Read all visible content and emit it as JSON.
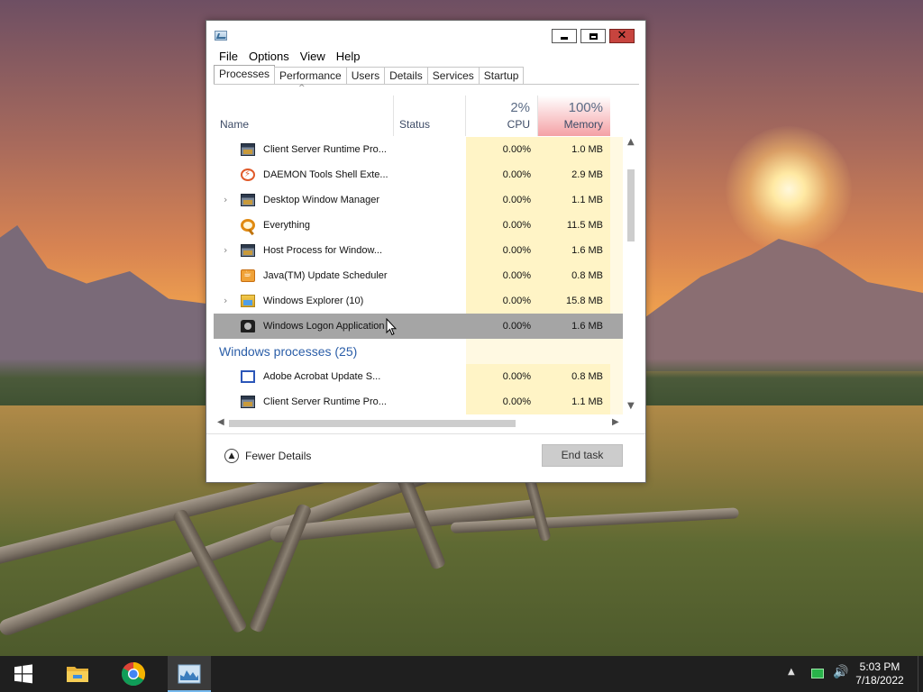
{
  "menu": [
    "File",
    "Options",
    "View",
    "Help"
  ],
  "tabs": [
    "Processes",
    "Performance",
    "Users",
    "Details",
    "Services",
    "Startup"
  ],
  "active_tab": "Processes",
  "header": {
    "name": "Name",
    "status": "Status",
    "cpu_pct": "2%",
    "cpu": "CPU",
    "mem_pct": "100%",
    "mem": "Memory"
  },
  "rows": [
    {
      "name": "Client Server Runtime Pro...",
      "icon": "window-icon",
      "expandable": false,
      "cpu": "0.00%",
      "mem": "1.0 MB"
    },
    {
      "name": "DAEMON Tools Shell Exte...",
      "icon": "daemon-tools-icon",
      "expandable": false,
      "cpu": "0.00%",
      "mem": "2.9 MB"
    },
    {
      "name": "Desktop Window Manager",
      "icon": "window-icon",
      "expandable": true,
      "cpu": "0.00%",
      "mem": "1.1 MB"
    },
    {
      "name": "Everything",
      "icon": "search-icon",
      "expandable": false,
      "cpu": "0.00%",
      "mem": "11.5 MB"
    },
    {
      "name": "Host Process for Window...",
      "icon": "window-icon",
      "expandable": true,
      "cpu": "0.00%",
      "mem": "1.6 MB"
    },
    {
      "name": "Java(TM) Update Scheduler",
      "icon": "java-icon",
      "expandable": false,
      "cpu": "0.00%",
      "mem": "0.8 MB"
    },
    {
      "name": "Windows Explorer (10)",
      "icon": "folder-icon",
      "expandable": true,
      "cpu": "0.00%",
      "mem": "15.8 MB"
    },
    {
      "name": "Windows Logon Application",
      "icon": "logon-icon",
      "expandable": false,
      "cpu": "0.00%",
      "mem": "1.6 MB",
      "selected": true
    }
  ],
  "group": "Windows processes (25)",
  "group_rows": [
    {
      "name": "Adobe Acrobat Update S...",
      "icon": "acrobat-icon",
      "expandable": false,
      "cpu": "0.00%",
      "mem": "0.8 MB"
    },
    {
      "name": "Client Server Runtime Pro...",
      "icon": "window-icon",
      "expandable": false,
      "cpu": "0.00%",
      "mem": "1.1 MB"
    }
  ],
  "footer": {
    "fewer_details": "Fewer Details",
    "end_task": "End task"
  },
  "taskbar": {
    "time": "5:03 PM",
    "date": "7/18/2022",
    "pinned": [
      "windows-start-icon",
      "file-explorer-icon",
      "chrome-icon",
      "task-manager-icon"
    ]
  }
}
